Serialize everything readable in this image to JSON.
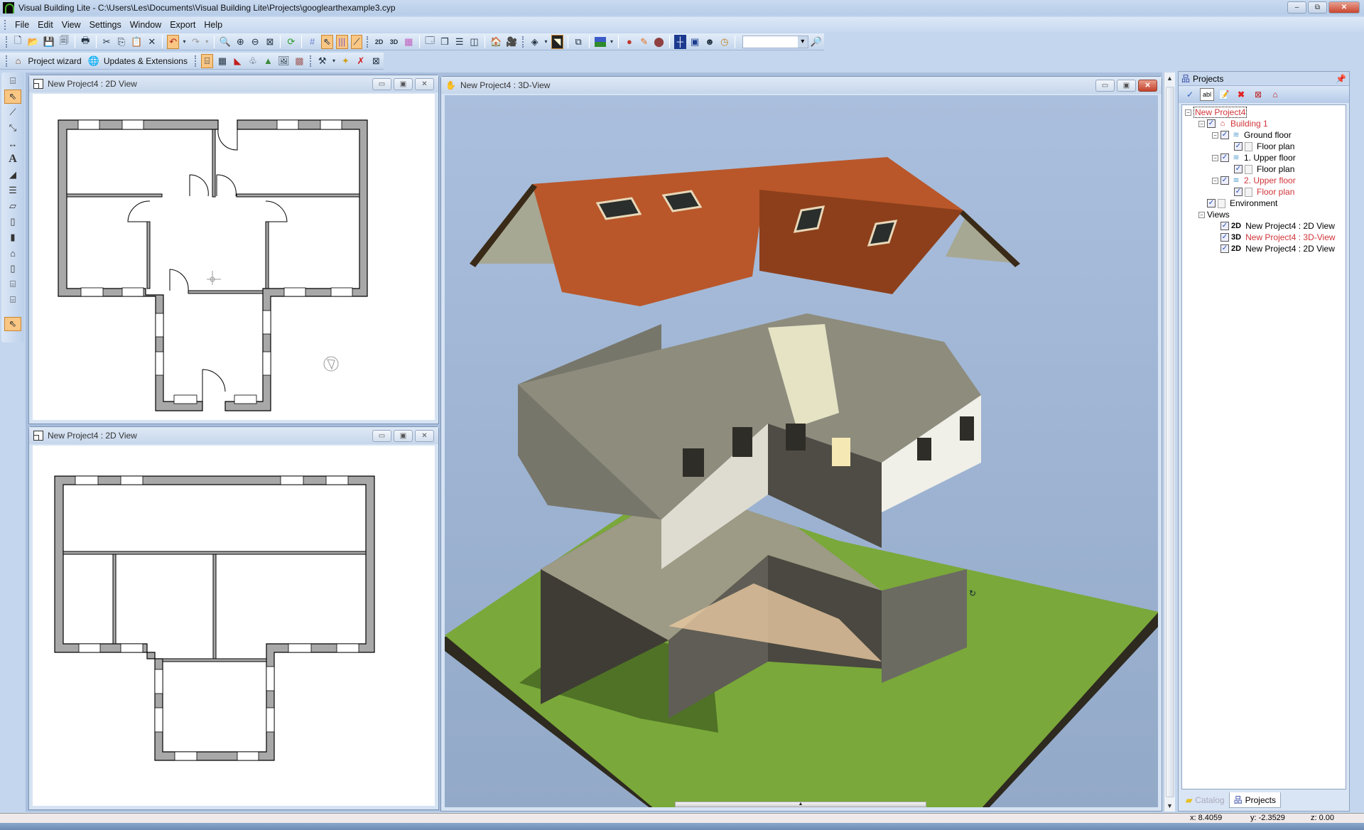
{
  "window": {
    "title": "Visual Building Lite - C:\\Users\\Les\\Documents\\Visual Building Lite\\Projects\\googlearthexample3.cyp",
    "minimize": "–",
    "restore": "⧉",
    "close": "✕"
  },
  "menu": [
    "File",
    "Edit",
    "View",
    "Settings",
    "Window",
    "Export",
    "Help"
  ],
  "toolbar1": {
    "icons": [
      "new-icon",
      "open-icon",
      "save-icon",
      "save-all-icon",
      "print-icon",
      "cut-icon",
      "copy-icon",
      "paste-icon",
      "delete-icon",
      "undo-icon",
      "redo-icon",
      "zoom-icon",
      "zoom-in-icon",
      "zoom-out-icon",
      "zoom-all-icon",
      "refresh-icon",
      "grid-icon",
      "select-snap-icon",
      "column-snap-icon",
      "guide-snap-icon",
      "new-2d-view-icon",
      "new-3d-view-icon",
      "layers-icon",
      "window-new-icon",
      "cascade-icon",
      "tile-horizontal-icon",
      "tile-vertical-icon",
      "save-image-icon",
      "camera-icon",
      "render-icon",
      "light-icon",
      "walk-icon",
      "sky-color-icon",
      "material-icon",
      "paint-icon",
      "texture-icon",
      "view-grid-icon",
      "view-frame-icon",
      "animation-icon",
      "sun-time-icon"
    ],
    "search_value": ""
  },
  "toolbar2": {
    "project_wizard": "Project wizard",
    "updates": "Updates & Extensions"
  },
  "left_tools": [
    "building-icon",
    "select-arrow-icon",
    "line-icon",
    "measure-icon",
    "dimension-icon",
    "text-icon",
    "wall-icon",
    "stair-icon",
    "slab-icon",
    "column-icon",
    "chimney-icon",
    "window-icon",
    "door-icon",
    "roof-icon",
    "dormer-icon",
    "select-arrow-icon"
  ],
  "views": {
    "top2d": {
      "title": "New Project4 : 2D View"
    },
    "bottom2d": {
      "title": "New Project4 : 2D View"
    },
    "view3d": {
      "title": "New Project4 : 3D-View"
    }
  },
  "projects_panel": {
    "title": "Projects",
    "tree": [
      {
        "label": "New Project4",
        "level": 0,
        "red": true,
        "selected": true,
        "expander": "⊟"
      },
      {
        "label": "Building 1",
        "level": 1,
        "red": true,
        "checked": true,
        "icon": "building-icon"
      },
      {
        "label": "Ground floor",
        "level": 2,
        "checked": true,
        "icon": "floor-icon"
      },
      {
        "label": "Floor plan",
        "level": 3,
        "checked": true,
        "icon": "page-icon"
      },
      {
        "label": "1. Upper floor",
        "level": 2,
        "checked": true,
        "icon": "floor-icon"
      },
      {
        "label": "Floor plan",
        "level": 3,
        "checked": true,
        "icon": "page-icon"
      },
      {
        "label": "2. Upper floor",
        "level": 2,
        "red": true,
        "checked": true,
        "icon": "floor-icon"
      },
      {
        "label": "Floor plan",
        "level": 3,
        "red": true,
        "checked": true,
        "icon": "page-icon"
      },
      {
        "label": "Environment",
        "level": 1,
        "checked": true,
        "icon": "page-icon"
      },
      {
        "label": "Views",
        "level": 1
      },
      {
        "label": "New Project4 : 2D View",
        "level": 2,
        "checked": true,
        "badge": "2D"
      },
      {
        "label": "New Project4 : 3D-View",
        "level": 2,
        "checked": true,
        "badge": "3D",
        "red": true
      },
      {
        "label": "New Project4 : 2D View",
        "level": 2,
        "checked": true,
        "badge": "2D"
      }
    ],
    "tabs": [
      "Catalog",
      "Projects"
    ],
    "active_tab": "Projects"
  },
  "status": {
    "x": "x: 8.4059",
    "y": "y: -2.3529",
    "z": "z: 0.00"
  },
  "colors": {
    "accent_highlight": "#f9c684",
    "wall_fill": "#a8a8a8",
    "roof": "#b9572a",
    "grass": "#7aa83a",
    "sky": "#a3b8d6",
    "tree_red": "#d0353a"
  }
}
